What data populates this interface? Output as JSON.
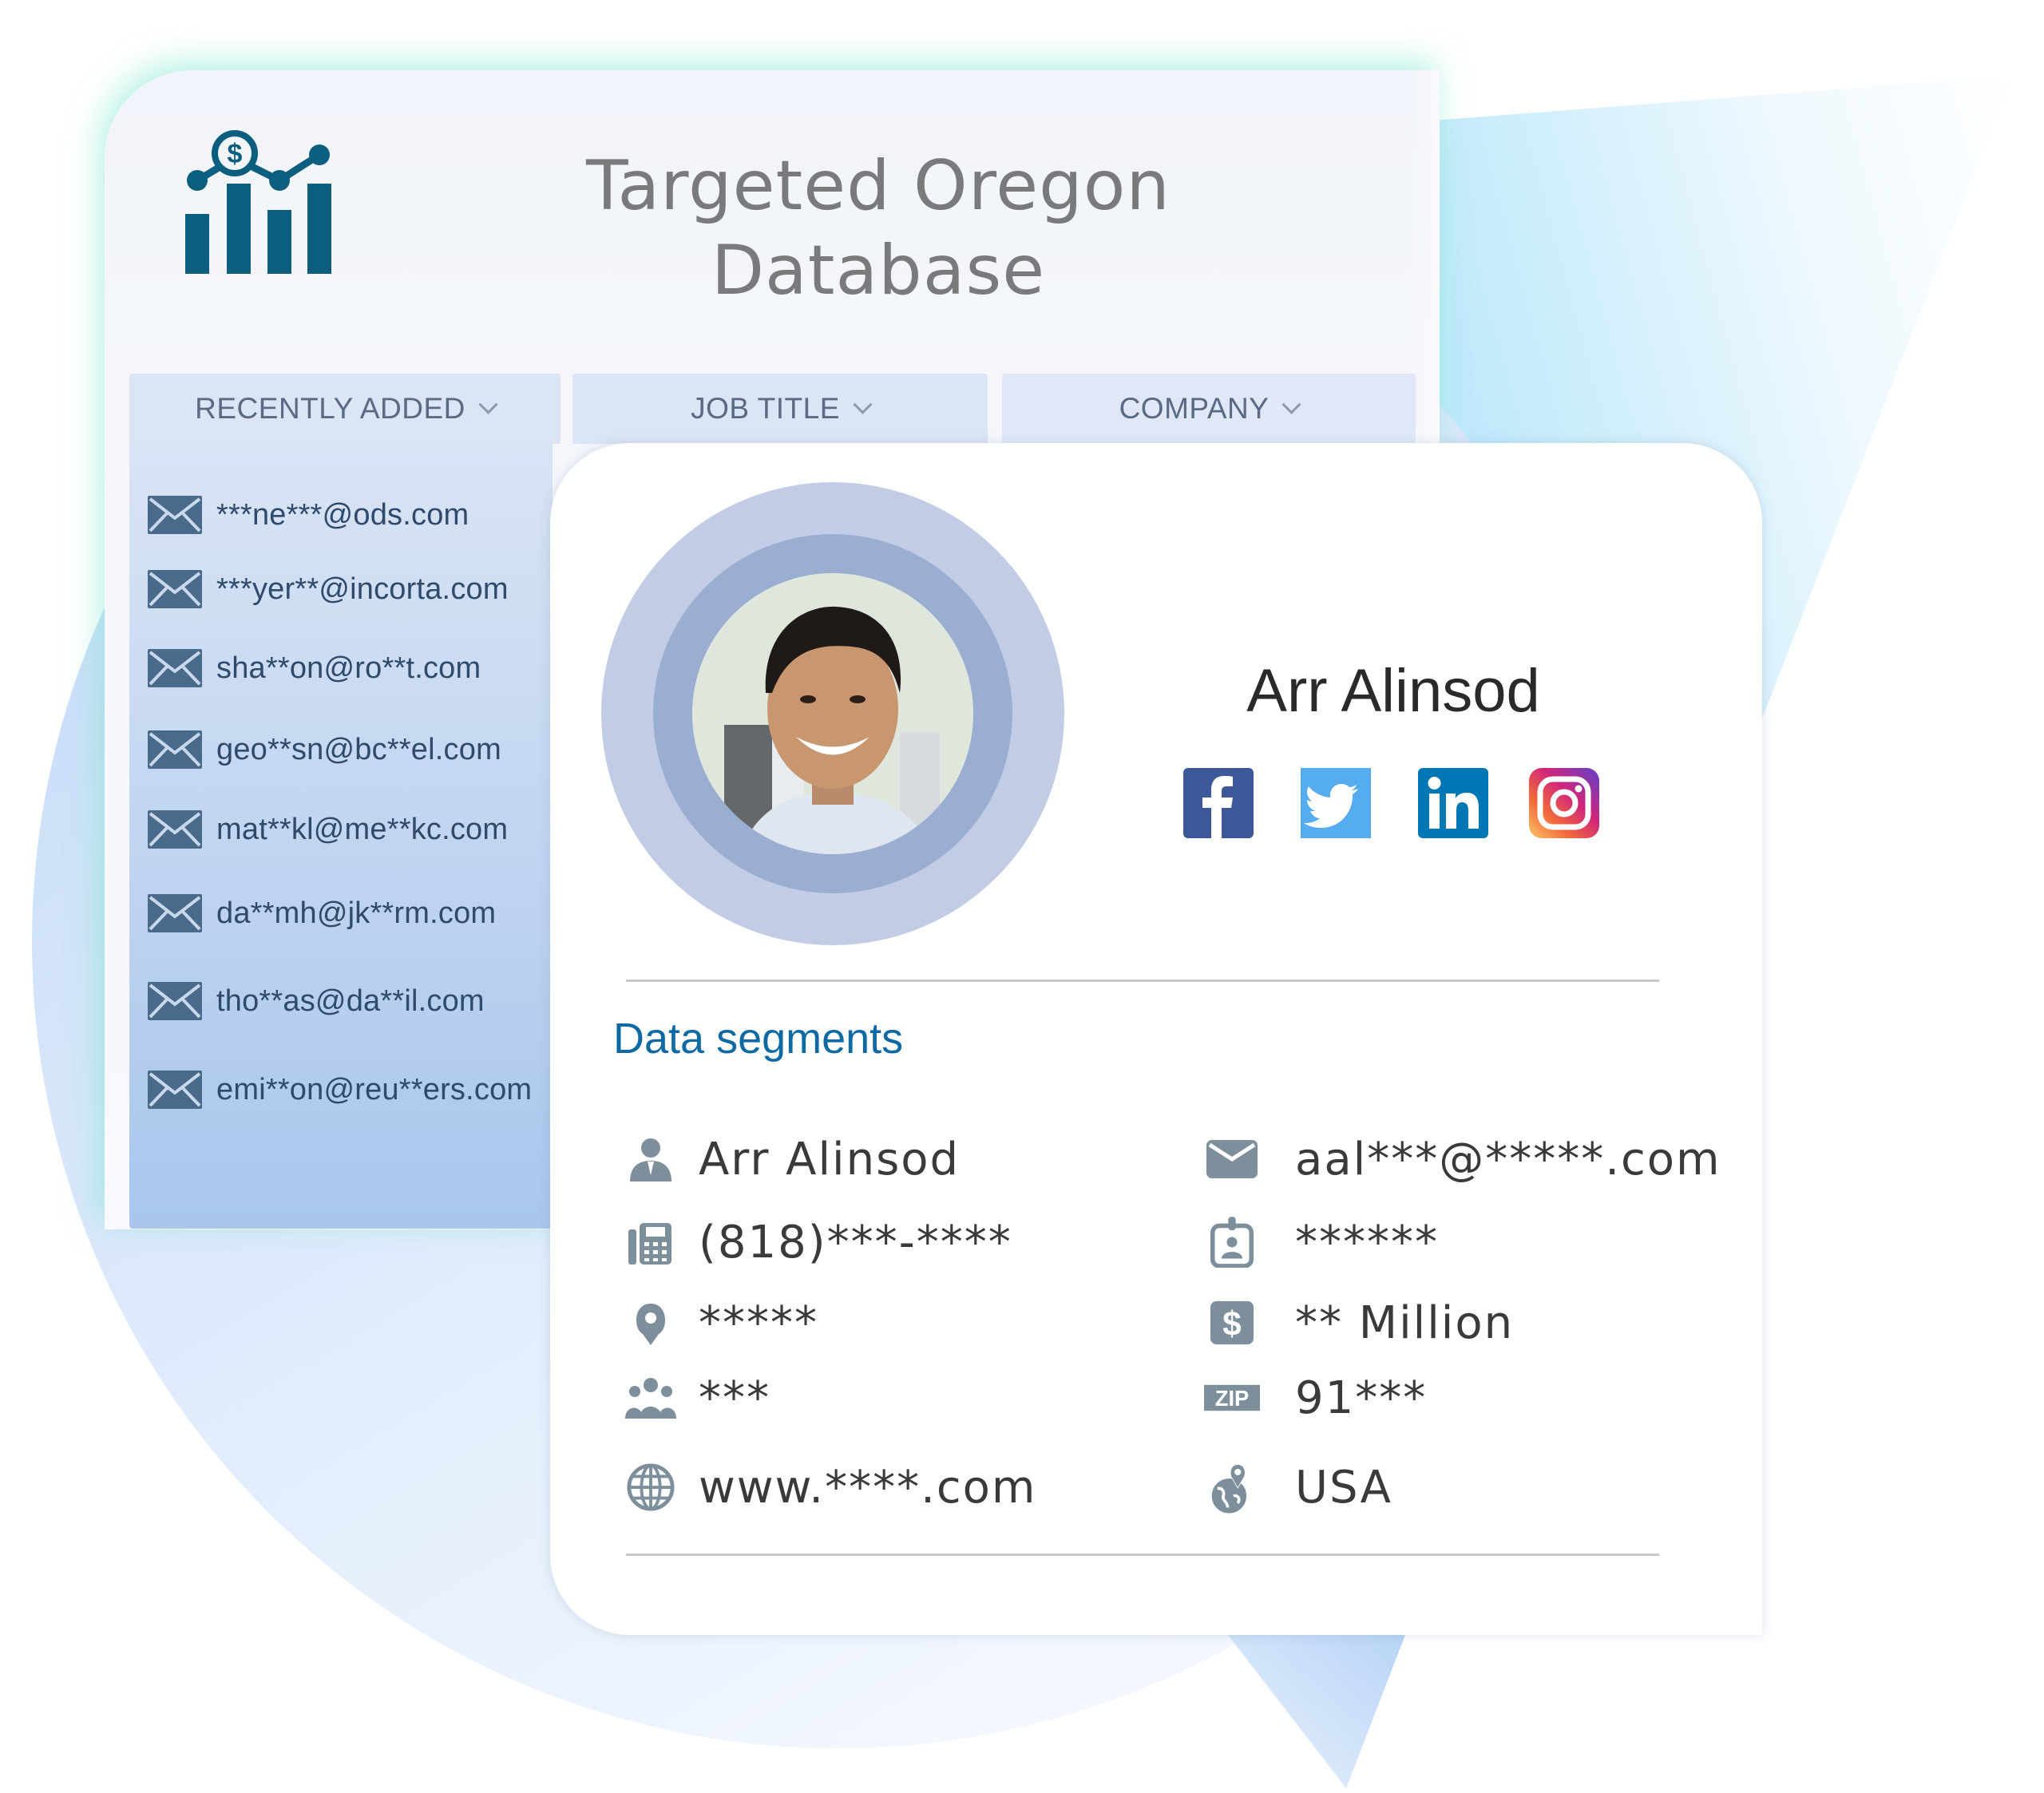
{
  "header": {
    "title_line1": "Targeted Oregon",
    "title_line2": "Database",
    "logo_icon": "chart-dollar-icon"
  },
  "tabs": [
    {
      "label": "RECENTLY ADDED",
      "icon": "chevron-down-icon"
    },
    {
      "label": "JOB TITLE",
      "icon": "chevron-down-icon"
    },
    {
      "label": "COMPANY",
      "icon": "chevron-down-icon"
    }
  ],
  "recent_emails": [
    "***ne***@ods.com",
    "***yer**@incorta.com",
    "sha**on@ro**t.com",
    "geo**sn@bc**el.com",
    "mat**kl@me**kc.com",
    "da**mh@jk**rm.com",
    "tho**as@da**il.com",
    "emi**on@reu**ers.com"
  ],
  "profile": {
    "name": "Arr Alinsod",
    "social": [
      {
        "name": "facebook",
        "color": "#3b5998"
      },
      {
        "name": "twitter",
        "color": "#55acee"
      },
      {
        "name": "linkedin",
        "color": "#0077b5"
      },
      {
        "name": "instagram",
        "color": "#c13584"
      }
    ]
  },
  "segments": {
    "title": "Data segments",
    "left": [
      {
        "icon": "person-icon",
        "value": "Arr Alinsod"
      },
      {
        "icon": "phone-fax-icon",
        "value": "(818)***-****"
      },
      {
        "icon": "location-pin-icon",
        "value": "*****"
      },
      {
        "icon": "group-icon",
        "value": "***"
      },
      {
        "icon": "globe-icon",
        "value": "www.****.com"
      }
    ],
    "right": [
      {
        "icon": "envelope-icon",
        "value": "aal***@*****.com"
      },
      {
        "icon": "id-badge-icon",
        "value": "******"
      },
      {
        "icon": "dollar-icon",
        "value": "** Million"
      },
      {
        "icon": "zip-icon",
        "value": "91***",
        "badge": "ZIP"
      },
      {
        "icon": "globe-pin-icon",
        "value": "USA"
      }
    ]
  },
  "colors": {
    "accent": "#0f6aa3",
    "logo": "#0b5e7e",
    "icon_gray": "#7d8f9b",
    "envelope": "#4a6a8c"
  }
}
